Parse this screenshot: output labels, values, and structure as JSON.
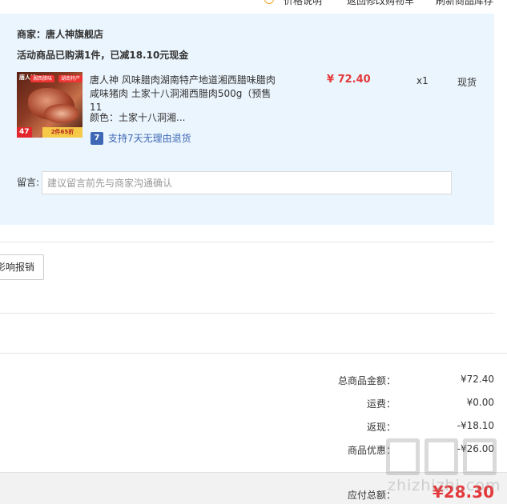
{
  "top_links": {
    "price_note": "价格说明",
    "back_to_cart": "返回修改购物车",
    "refresh_stock": "刷新商品库存"
  },
  "shop": {
    "name": "商家：唐人神旗舰店",
    "promo": "活动商品已购满1件，已减18.10元现金"
  },
  "item": {
    "thumb_brand": "唐人神",
    "thumb_tag1": "湘西腊味",
    "thumb_tag2": "湖南特产",
    "thumb_price": "47",
    "thumb_sale": "2件65折",
    "title": "唐人神 风味腊肉湖南特产地道湘西腊味腊肉咸味猪肉 土家十八洞湘西腊肉500g（预售11",
    "color_label": "颜色：土家十八洞湘...",
    "return_badge": "7",
    "return_text": "支持7天无理由退货",
    "price": "¥ 72.40",
    "qty": "x1",
    "stock": "现货"
  },
  "remark": {
    "label": "留言:",
    "placeholder": "建议留言前先与商家沟通确认"
  },
  "invoice": {
    "button": "影响报销"
  },
  "summary": {
    "rows": [
      {
        "label": "总商品金额：",
        "value": "¥72.40"
      },
      {
        "label": "运费：",
        "value": "¥0.00"
      },
      {
        "label": "返现：",
        "value": "-¥18.10"
      },
      {
        "label": "商品优惠：",
        "value": "-¥26.00"
      }
    ],
    "payable_label": "应付总额：",
    "payable_value": "¥28.30"
  },
  "watermark": {
    "text": "zhizhizhi.com"
  },
  "colors": {
    "panel_bg": "#ebf5fd",
    "price_red": "#e4393c",
    "link_blue": "#3e68b5"
  }
}
